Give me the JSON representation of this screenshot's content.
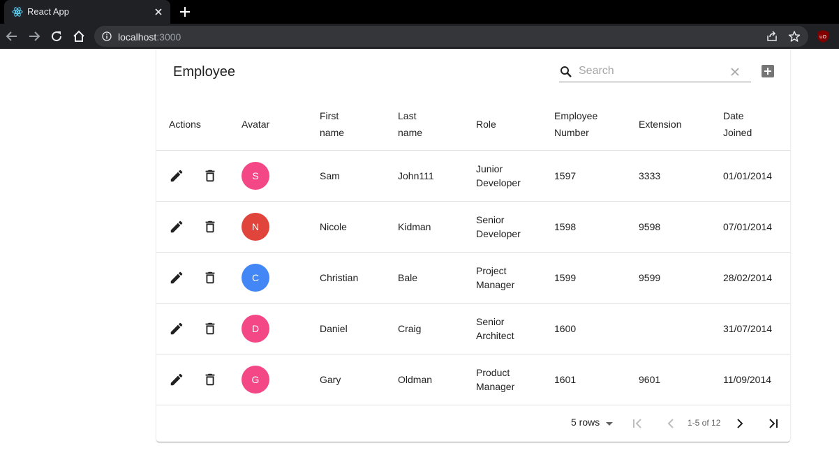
{
  "browser": {
    "tab_title": "React App",
    "url_host": "localhost",
    "url_port": ":3000"
  },
  "table": {
    "title": "Employee",
    "search_placeholder": "Search",
    "columns": [
      {
        "line1": "Actions",
        "line2": ""
      },
      {
        "line1": "Avatar",
        "line2": ""
      },
      {
        "line1": "First",
        "line2": "name"
      },
      {
        "line1": "Last",
        "line2": "name"
      },
      {
        "line1": "Role",
        "line2": ""
      },
      {
        "line1": "Employee",
        "line2": "Number"
      },
      {
        "line1": "Extension",
        "line2": ""
      },
      {
        "line1": "Date",
        "line2": "Joined"
      }
    ],
    "rows": [
      {
        "avatar": "S",
        "avatar_color": "#f44786",
        "first": "Sam",
        "last": "John111",
        "role1": "Junior",
        "role2": "Developer",
        "number": "1597",
        "extension": "3333",
        "joined": "01/01/2014"
      },
      {
        "avatar": "N",
        "avatar_color": "#e0443a",
        "first": "Nicole",
        "last": "Kidman",
        "role1": "Senior",
        "role2": "Developer",
        "number": "1598",
        "extension": "9598",
        "joined": "07/01/2014"
      },
      {
        "avatar": "C",
        "avatar_color": "#4287f5",
        "first": "Christian",
        "last": "Bale",
        "role1": "Project",
        "role2": "Manager",
        "number": "1599",
        "extension": "9599",
        "joined": "28/02/2014"
      },
      {
        "avatar": "D",
        "avatar_color": "#f44786",
        "first": "Daniel",
        "last": "Craig",
        "role1": "Senior",
        "role2": "Architect",
        "number": "1600",
        "extension": "",
        "joined": "31/07/2014"
      },
      {
        "avatar": "G",
        "avatar_color": "#f44786",
        "first": "Gary",
        "last": "Oldman",
        "role1": "Product",
        "role2": "Manager",
        "number": "1601",
        "extension": "9601",
        "joined": "11/09/2014"
      }
    ],
    "pagination": {
      "rows_per_page": "5 rows",
      "page_info": "1-5 of 12"
    }
  }
}
